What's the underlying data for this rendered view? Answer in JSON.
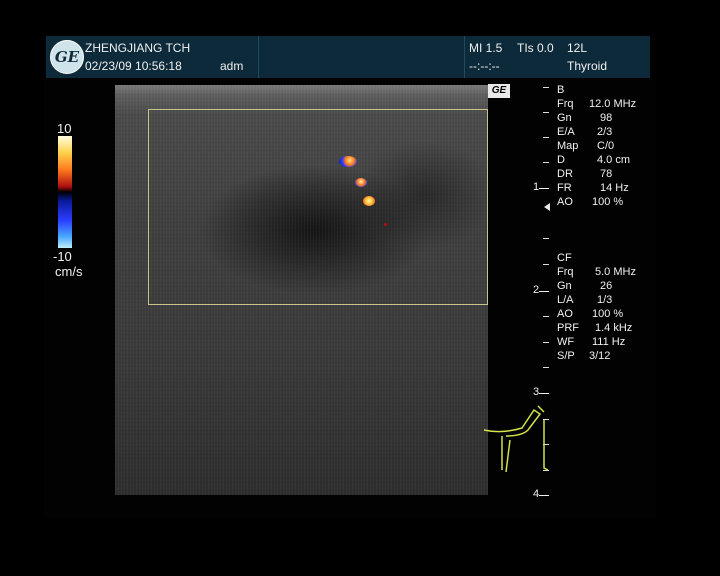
{
  "header": {
    "institution": "ZHENGJIANG TCH",
    "datetime": "02/23/09 10:56:18",
    "operator": "adm",
    "mi": "MI 1.5",
    "tis": "TIs 0.0",
    "placeholder_time": "--:--:--",
    "probe": "12L",
    "preset": "Thyroid",
    "logo_text": "GE"
  },
  "color_scale": {
    "max": "10",
    "min": "-10",
    "unit": "cm/s"
  },
  "b_mode_params": [
    {
      "label": "B",
      "value": ""
    },
    {
      "label": "Frq",
      "value": "12.0 MHz"
    },
    {
      "label": "Gn",
      "value": "98"
    },
    {
      "label": "E/A",
      "value": "2/3"
    },
    {
      "label": "Map",
      "value": "C/0"
    },
    {
      "label": "D",
      "value": "4.0 cm"
    },
    {
      "label": "DR",
      "value": "78"
    },
    {
      "label": "FR",
      "value": "14 Hz"
    },
    {
      "label": "AO",
      "value": "100 %"
    }
  ],
  "cf_params": [
    {
      "label": "CF",
      "value": ""
    },
    {
      "label": "Frq",
      "value": "5.0 MHz"
    },
    {
      "label": "Gn",
      "value": "26"
    },
    {
      "label": "L/A",
      "value": "1/3"
    },
    {
      "label": "AO",
      "value": "100 %"
    },
    {
      "label": "PRF",
      "value": "1.4 kHz"
    },
    {
      "label": "WF",
      "value": "111 Hz"
    },
    {
      "label": "S/P",
      "value": "3/12"
    }
  ],
  "depth_scale": [
    "1",
    "2",
    "3",
    "4"
  ],
  "image_corner_mark": "GE",
  "colors": {
    "header_bg": "#0d2a3a",
    "roi_outline": "#c8c48a",
    "probe_icon": "#d6e24a"
  }
}
